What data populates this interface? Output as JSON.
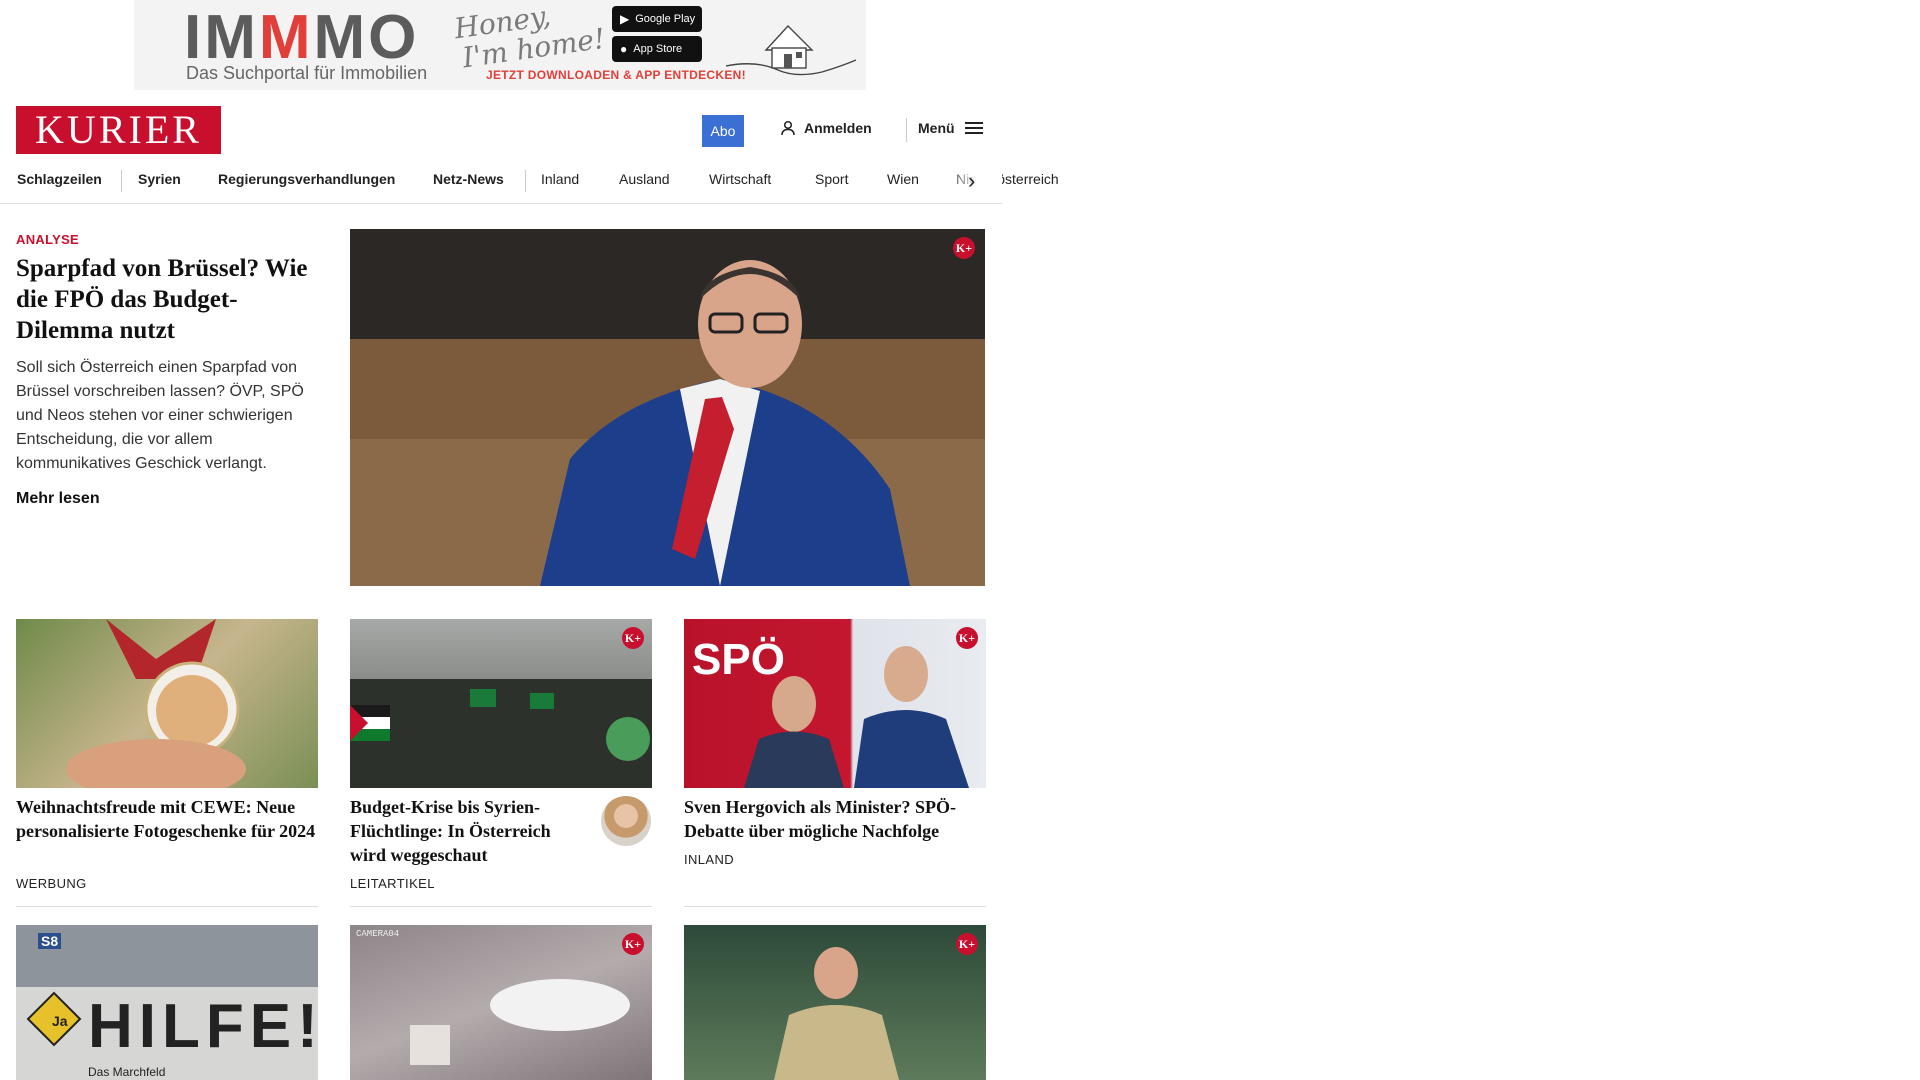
{
  "ad": {
    "brand_pre": "IM",
    "brand_m": "M",
    "brand_post": "MO",
    "tagline": "Das Suchportal für Immobilien",
    "script_line1": "Honey,",
    "script_line2": "I'm home!",
    "google_play": "Google Play",
    "app_store": "App Store",
    "cta": "JETZT DOWNLOADEN & APP ENTDECKEN!"
  },
  "header": {
    "logo": "KURIER",
    "abo": "Abo",
    "login": "Anmelden",
    "menu": "Menü"
  },
  "nav": {
    "items": [
      "Schlagzeilen",
      "Syrien",
      "Regierungsverhandlungen",
      "Netz-News",
      "Inland",
      "Ausland",
      "Wirtschaft",
      "Sport",
      "Wien",
      "Niederösterreich"
    ]
  },
  "lead": {
    "kicker": "ANALYSE",
    "title": "Sparpfad von Brüssel? Wie die FPÖ das Budget-Dilemma nutzt",
    "text": "Soll sich Österreich einen Sparpfad von Brüssel vorschreiben lassen? ÖVP, SPÖ und Neos stehen vor einer schwierigen Entscheidung, die vor allem kommunikatives Geschick verlangt.",
    "more": "Mehr lesen",
    "plus_badge": "K+"
  },
  "cards": [
    {
      "title": "Weihnachtsfreude mit CEWE: Neue personalisierte Fotogeschenke für 2024",
      "category": "WERBUNG"
    },
    {
      "title": "Budget-Krise bis Syrien-Flüchtlinge: In Österreich wird weggeschaut",
      "category": "LEITARTIKEL",
      "plus_badge": "K+"
    },
    {
      "title": "Sven Hergovich als Minister? SPÖ-Debatte über mögliche Nachfolge",
      "category": "INLAND",
      "plus_badge": "K+",
      "image_text": "SPÖ"
    }
  ],
  "row2": {
    "img1_text": "HILFE!",
    "img1_sub": "Das Marchfeld",
    "img1_badge": "Ja",
    "img1_sign": "S8",
    "img2_text": "CAMERA04",
    "plus_badge": "K+"
  }
}
